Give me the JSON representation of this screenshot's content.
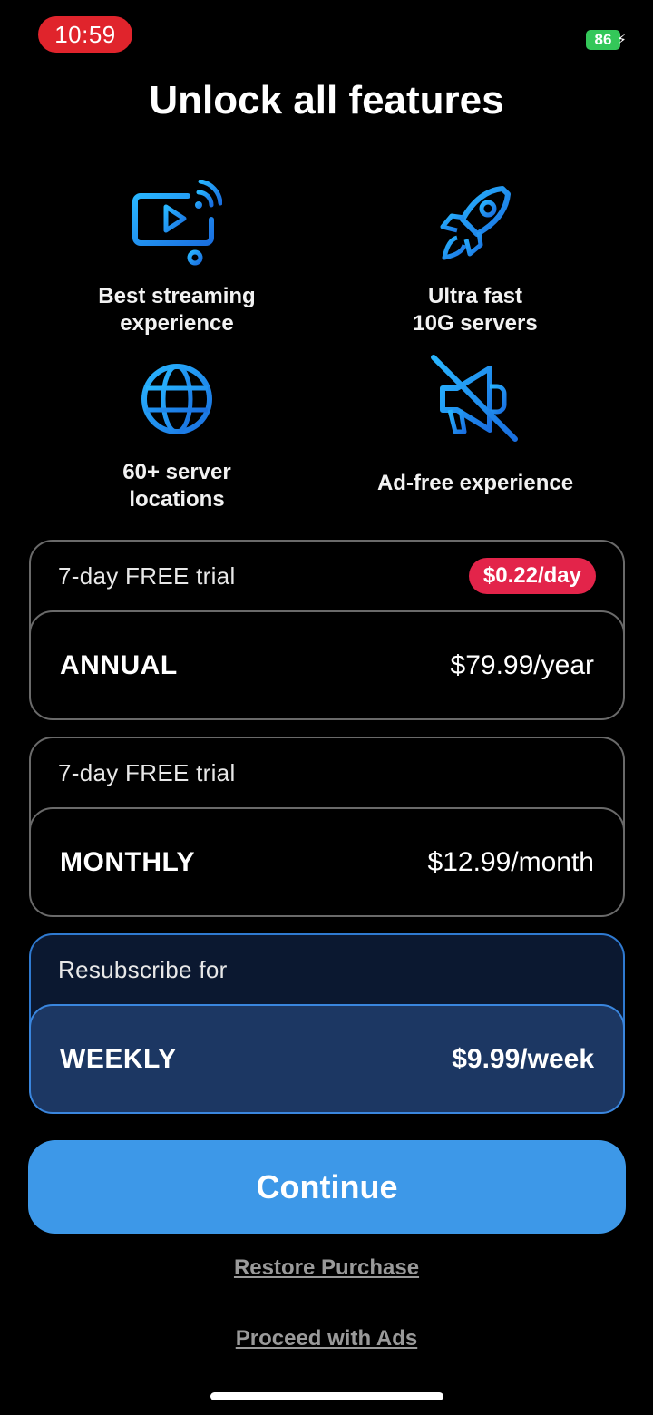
{
  "status": {
    "time": "10:59",
    "battery": "86"
  },
  "title": "Unlock all features",
  "features": [
    {
      "label": "Best streaming\nexperience",
      "icon": "tv-stream-icon"
    },
    {
      "label": "Ultra fast\n10G servers",
      "icon": "rocket-icon"
    },
    {
      "label": "60+ server\nlocations",
      "icon": "globe-icon"
    },
    {
      "label": "Ad-free experience",
      "icon": "no-ads-megaphone-icon"
    }
  ],
  "plans": [
    {
      "top_label": "7-day FREE trial",
      "badge": "$0.22/day",
      "name": "ANNUAL",
      "price": "$79.99/year",
      "selected": false
    },
    {
      "top_label": "7-day FREE trial",
      "name": "MONTHLY",
      "price": "$12.99/month",
      "selected": false
    },
    {
      "top_label": "Resubscribe for",
      "name": "WEEKLY",
      "price": "$9.99/week",
      "selected": true
    }
  ],
  "continue_label": "Continue",
  "restore_label": "Restore Purchase",
  "proceed_label": "Proceed with Ads",
  "colors": {
    "accent": "#3d98e8",
    "badge": "#e3244a",
    "icon_blue": "#1ea0ff"
  }
}
